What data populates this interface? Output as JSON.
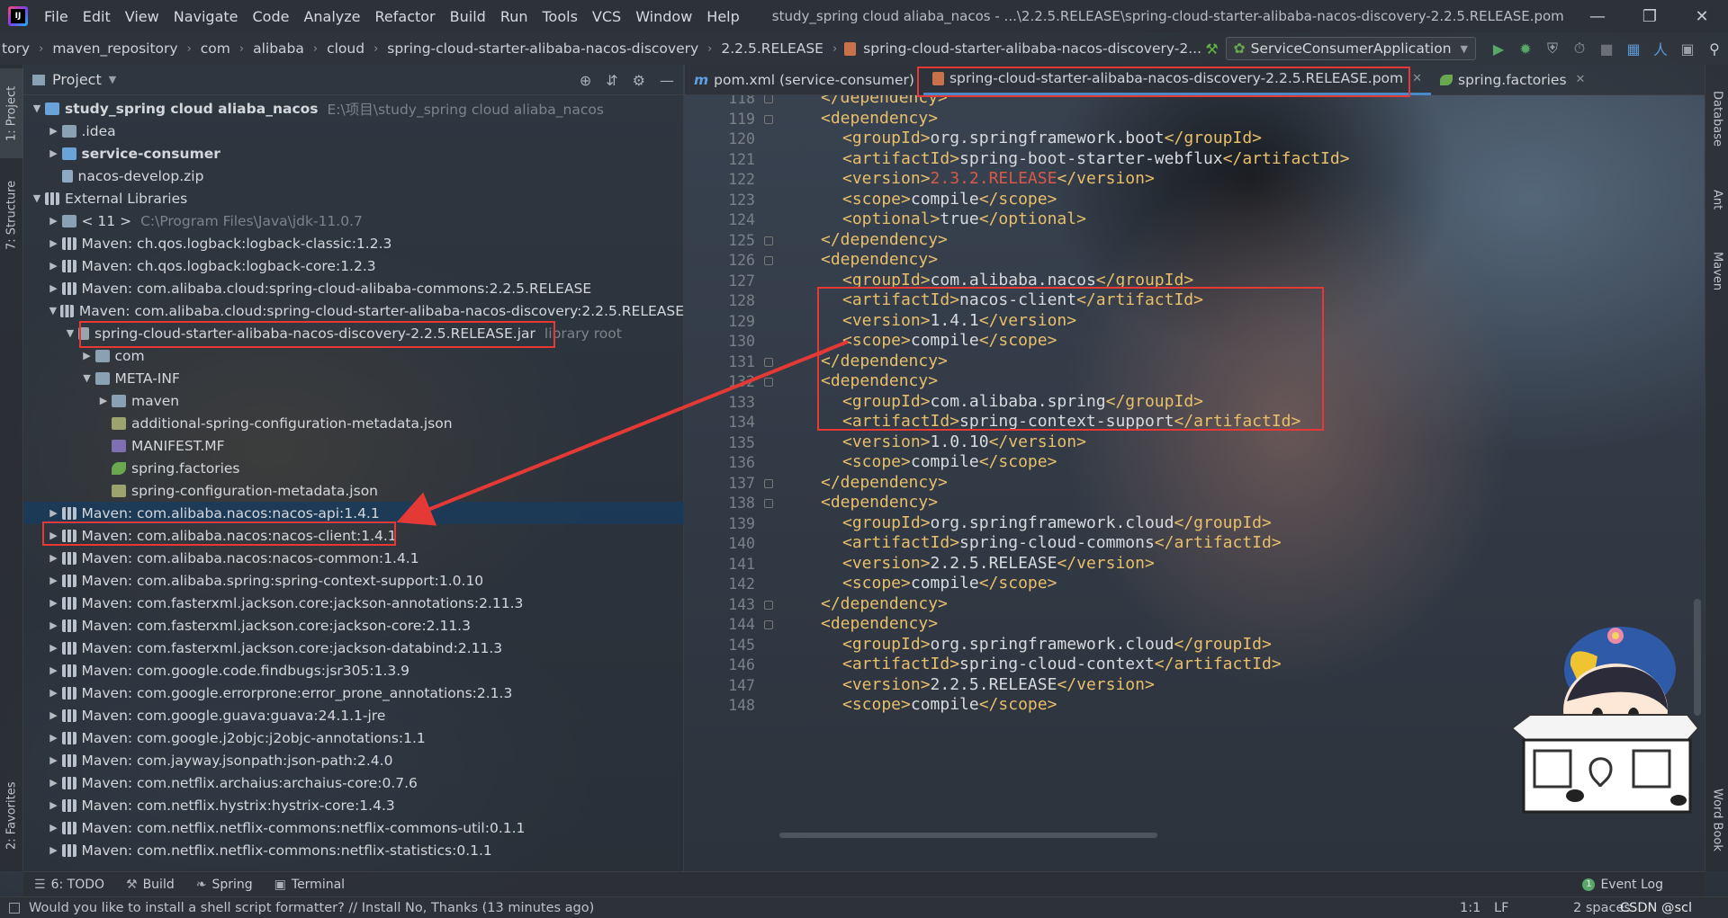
{
  "menubar": {
    "items": [
      "File",
      "Edit",
      "View",
      "Navigate",
      "Code",
      "Analyze",
      "Refactor",
      "Build",
      "Run",
      "Tools",
      "VCS",
      "Window",
      "Help"
    ],
    "window_title": "study_spring cloud aliaba_nacos - ...\\2.2.5.RELEASE\\spring-cloud-starter-alibaba-nacos-discovery-2.2.5.RELEASE.pom"
  },
  "breadcrumb": [
    "tory",
    "maven_repository",
    "com",
    "alibaba",
    "cloud",
    "spring-cloud-starter-alibaba-nacos-discovery",
    "2.2.5.RELEASE",
    "spring-cloud-starter-alibaba-nacos-discovery-2..."
  ],
  "run_config": "ServiceConsumerApplication",
  "left_strip": {
    "project_tab": "1: Project",
    "structure_tab": "7: Structure",
    "favorites_tab": "2: Favorites"
  },
  "right_strip": {
    "database_tab": "Database",
    "ant_tab": "Ant",
    "maven_tab": "Maven",
    "wordbook_tab": "Word Book"
  },
  "project_panel": {
    "title": "Project",
    "tree": [
      {
        "indent": 0,
        "arrow": "down",
        "icon": "folder-blue",
        "text": "study_spring cloud aliaba_nacos",
        "bold": true,
        "dim": "E:\\项目\\study_spring cloud aliaba_nacos"
      },
      {
        "indent": 1,
        "arrow": "right",
        "icon": "folder",
        "text": ".idea"
      },
      {
        "indent": 1,
        "arrow": "right",
        "icon": "folder-blue",
        "text": "service-consumer",
        "bold": true
      },
      {
        "indent": 1,
        "arrow": "",
        "icon": "zip",
        "text": "nacos-develop.zip"
      },
      {
        "indent": 0,
        "arrow": "down",
        "icon": "lib",
        "text": "External Libraries"
      },
      {
        "indent": 1,
        "arrow": "right",
        "icon": "folder",
        "text": "< 11 >",
        "dim": "C:\\Program Files\\Java\\jdk-11.0.7"
      },
      {
        "indent": 1,
        "arrow": "right",
        "icon": "lib",
        "text": "Maven: ch.qos.logback:logback-classic:1.2.3"
      },
      {
        "indent": 1,
        "arrow": "right",
        "icon": "lib",
        "text": "Maven: ch.qos.logback:logback-core:1.2.3"
      },
      {
        "indent": 1,
        "arrow": "right",
        "icon": "lib",
        "text": "Maven: com.alibaba.cloud:spring-cloud-alibaba-commons:2.2.5.RELEASE"
      },
      {
        "indent": 1,
        "arrow": "down",
        "icon": "lib",
        "text": "Maven: com.alibaba.cloud:spring-cloud-starter-alibaba-nacos-discovery:2.2.5.RELEASE"
      },
      {
        "indent": 2,
        "arrow": "down",
        "icon": "jar",
        "text": "spring-cloud-starter-alibaba-nacos-discovery-2.2.5.RELEASE.jar",
        "dim": "library root"
      },
      {
        "indent": 3,
        "arrow": "right",
        "icon": "folder",
        "text": "com"
      },
      {
        "indent": 3,
        "arrow": "down",
        "icon": "folder",
        "text": "META-INF"
      },
      {
        "indent": 4,
        "arrow": "right",
        "icon": "folder",
        "text": "maven"
      },
      {
        "indent": 4,
        "arrow": "",
        "icon": "json",
        "text": "additional-spring-configuration-metadata.json"
      },
      {
        "indent": 4,
        "arrow": "",
        "icon": "mf",
        "text": "MANIFEST.MF"
      },
      {
        "indent": 4,
        "arrow": "",
        "icon": "leaf",
        "text": "spring.factories"
      },
      {
        "indent": 4,
        "arrow": "",
        "icon": "json",
        "text": "spring-configuration-metadata.json"
      },
      {
        "indent": 1,
        "arrow": "right",
        "icon": "lib",
        "text": "Maven: com.alibaba.nacos:nacos-api:1.4.1",
        "selected": true
      },
      {
        "indent": 1,
        "arrow": "right",
        "icon": "lib",
        "text": "Maven: com.alibaba.nacos:nacos-client:1.4.1"
      },
      {
        "indent": 1,
        "arrow": "right",
        "icon": "lib",
        "text": "Maven: com.alibaba.nacos:nacos-common:1.4.1"
      },
      {
        "indent": 1,
        "arrow": "right",
        "icon": "lib",
        "text": "Maven: com.alibaba.spring:spring-context-support:1.0.10"
      },
      {
        "indent": 1,
        "arrow": "right",
        "icon": "lib",
        "text": "Maven: com.fasterxml.jackson.core:jackson-annotations:2.11.3"
      },
      {
        "indent": 1,
        "arrow": "right",
        "icon": "lib",
        "text": "Maven: com.fasterxml.jackson.core:jackson-core:2.11.3"
      },
      {
        "indent": 1,
        "arrow": "right",
        "icon": "lib",
        "text": "Maven: com.fasterxml.jackson.core:jackson-databind:2.11.3"
      },
      {
        "indent": 1,
        "arrow": "right",
        "icon": "lib",
        "text": "Maven: com.google.code.findbugs:jsr305:1.3.9"
      },
      {
        "indent": 1,
        "arrow": "right",
        "icon": "lib",
        "text": "Maven: com.google.errorprone:error_prone_annotations:2.1.3"
      },
      {
        "indent": 1,
        "arrow": "right",
        "icon": "lib",
        "text": "Maven: com.google.guava:guava:24.1.1-jre"
      },
      {
        "indent": 1,
        "arrow": "right",
        "icon": "lib",
        "text": "Maven: com.google.j2objc:j2objc-annotations:1.1"
      },
      {
        "indent": 1,
        "arrow": "right",
        "icon": "lib",
        "text": "Maven: com.jayway.jsonpath:json-path:2.4.0"
      },
      {
        "indent": 1,
        "arrow": "right",
        "icon": "lib",
        "text": "Maven: com.netflix.archaius:archaius-core:0.7.6"
      },
      {
        "indent": 1,
        "arrow": "right",
        "icon": "lib",
        "text": "Maven: com.netflix.hystrix:hystrix-core:1.4.3"
      },
      {
        "indent": 1,
        "arrow": "right",
        "icon": "lib",
        "text": "Maven: com.netflix.netflix-commons:netflix-commons-util:0.1.1"
      },
      {
        "indent": 1,
        "arrow": "right",
        "icon": "lib",
        "text": "Maven: com.netflix.netflix-commons:netflix-statistics:0.1.1"
      }
    ]
  },
  "editor_tabs": [
    {
      "label": "pom.xml (service-consumer)",
      "icon": "m-icon",
      "active": false,
      "close": false
    },
    {
      "label": "spring-cloud-starter-alibaba-nacos-discovery-2.2.5.RELEASE.pom",
      "icon": "xml-icon",
      "active": true,
      "close": true
    },
    {
      "label": "spring.factories",
      "icon": "leaf-icon",
      "active": false,
      "close": true
    }
  ],
  "editor": {
    "lines": [
      {
        "n": "118",
        "indent": 1,
        "parts": [
          [
            "tag",
            "</dependency>"
          ]
        ]
      },
      {
        "n": "119",
        "indent": 1,
        "parts": [
          [
            "tag",
            "<dependency>"
          ]
        ]
      },
      {
        "n": "120",
        "indent": 2,
        "parts": [
          [
            "tag",
            "<groupId>"
          ],
          [
            "text",
            "org.springframework.boot"
          ],
          [
            "tag",
            "</groupId>"
          ]
        ]
      },
      {
        "n": "121",
        "indent": 2,
        "parts": [
          [
            "tag",
            "<artifactId>"
          ],
          [
            "text",
            "spring-boot-starter-webflux"
          ],
          [
            "tag",
            "</artifactId>"
          ]
        ]
      },
      {
        "n": "122",
        "indent": 2,
        "parts": [
          [
            "tag",
            "<version>"
          ],
          [
            "red",
            "2.3.2.RELEASE"
          ],
          [
            "tag",
            "</version>"
          ]
        ]
      },
      {
        "n": "123",
        "indent": 2,
        "parts": [
          [
            "tag",
            "<scope>"
          ],
          [
            "text",
            "compile"
          ],
          [
            "tag",
            "</scope>"
          ]
        ]
      },
      {
        "n": "124",
        "indent": 2,
        "parts": [
          [
            "tag",
            "<optional>"
          ],
          [
            "text",
            "true"
          ],
          [
            "tag",
            "</optional>"
          ]
        ]
      },
      {
        "n": "125",
        "indent": 1,
        "parts": [
          [
            "tag",
            "</dependency>"
          ]
        ]
      },
      {
        "n": "126",
        "indent": 1,
        "parts": [
          [
            "tag",
            "<dependency>"
          ]
        ]
      },
      {
        "n": "127",
        "indent": 2,
        "parts": [
          [
            "tag",
            "<groupId>"
          ],
          [
            "text",
            "com.alibaba.nacos"
          ],
          [
            "tag",
            "</groupId>"
          ]
        ]
      },
      {
        "n": "128",
        "indent": 2,
        "parts": [
          [
            "tag",
            "<artifactId>"
          ],
          [
            "text",
            "nacos-client"
          ],
          [
            "tag",
            "</artifactId>"
          ]
        ]
      },
      {
        "n": "129",
        "indent": 2,
        "parts": [
          [
            "tag",
            "<version>"
          ],
          [
            "text",
            "1.4.1"
          ],
          [
            "tag",
            "</version>"
          ]
        ]
      },
      {
        "n": "130",
        "indent": 2,
        "parts": [
          [
            "tag",
            "<scope>"
          ],
          [
            "text",
            "compile"
          ],
          [
            "tag",
            "</scope>"
          ]
        ]
      },
      {
        "n": "131",
        "indent": 1,
        "parts": [
          [
            "tag",
            "</dependency>"
          ]
        ]
      },
      {
        "n": "132",
        "indent": 1,
        "parts": [
          [
            "tag",
            "<dependency>"
          ]
        ]
      },
      {
        "n": "133",
        "indent": 2,
        "parts": [
          [
            "tag",
            "<groupId>"
          ],
          [
            "text",
            "com.alibaba.spring"
          ],
          [
            "tag",
            "</groupId>"
          ]
        ]
      },
      {
        "n": "134",
        "indent": 2,
        "parts": [
          [
            "tag",
            "<artifactId>"
          ],
          [
            "text",
            "spring-context-support"
          ],
          [
            "tag",
            "</artifactId>"
          ]
        ]
      },
      {
        "n": "135",
        "indent": 2,
        "parts": [
          [
            "tag",
            "<version>"
          ],
          [
            "text",
            "1.0.10"
          ],
          [
            "tag",
            "</version>"
          ]
        ]
      },
      {
        "n": "136",
        "indent": 2,
        "parts": [
          [
            "tag",
            "<scope>"
          ],
          [
            "text",
            "compile"
          ],
          [
            "tag",
            "</scope>"
          ]
        ]
      },
      {
        "n": "137",
        "indent": 1,
        "parts": [
          [
            "tag",
            "</dependency>"
          ]
        ]
      },
      {
        "n": "138",
        "indent": 1,
        "parts": [
          [
            "tag",
            "<dependency>"
          ]
        ]
      },
      {
        "n": "139",
        "indent": 2,
        "parts": [
          [
            "tag",
            "<groupId>"
          ],
          [
            "text",
            "org.springframework.cloud"
          ],
          [
            "tag",
            "</groupId>"
          ]
        ]
      },
      {
        "n": "140",
        "indent": 2,
        "parts": [
          [
            "tag",
            "<artifactId>"
          ],
          [
            "text",
            "spring-cloud-commons"
          ],
          [
            "tag",
            "</artifactId>"
          ]
        ]
      },
      {
        "n": "141",
        "indent": 2,
        "parts": [
          [
            "tag",
            "<version>"
          ],
          [
            "text",
            "2.2.5.RELEASE"
          ],
          [
            "tag",
            "</version>"
          ]
        ]
      },
      {
        "n": "142",
        "indent": 2,
        "parts": [
          [
            "tag",
            "<scope>"
          ],
          [
            "text",
            "compile"
          ],
          [
            "tag",
            "</scope>"
          ]
        ]
      },
      {
        "n": "143",
        "indent": 1,
        "parts": [
          [
            "tag",
            "</dependency>"
          ]
        ]
      },
      {
        "n": "144",
        "indent": 1,
        "parts": [
          [
            "tag",
            "<dependency>"
          ]
        ]
      },
      {
        "n": "145",
        "indent": 2,
        "parts": [
          [
            "tag",
            "<groupId>"
          ],
          [
            "text",
            "org.springframework.cloud"
          ],
          [
            "tag",
            "</groupId>"
          ]
        ]
      },
      {
        "n": "146",
        "indent": 2,
        "parts": [
          [
            "tag",
            "<artifactId>"
          ],
          [
            "text",
            "spring-cloud-context"
          ],
          [
            "tag",
            "</artifactId>"
          ]
        ]
      },
      {
        "n": "147",
        "indent": 2,
        "parts": [
          [
            "tag",
            "<version>"
          ],
          [
            "text",
            "2.2.5.RELEASE"
          ],
          [
            "tag",
            "</version>"
          ]
        ]
      },
      {
        "n": "148",
        "indent": 2,
        "parts": [
          [
            "tag",
            "<scope>"
          ],
          [
            "text",
            "compile"
          ],
          [
            "tag",
            "</scope>"
          ]
        ]
      }
    ]
  },
  "tool_windows": [
    {
      "label": "6: TODO",
      "icon": "list-icon"
    },
    {
      "label": "Build",
      "icon": "hammer-icon"
    },
    {
      "label": "Spring",
      "icon": "leaf-icon"
    },
    {
      "label": "Terminal",
      "icon": "terminal-icon"
    }
  ],
  "event_log": {
    "label": "Event Log",
    "count": "1"
  },
  "status": {
    "message": "Would you like to install a shell script formatter? // Install   No, Thanks (13 minutes ago)",
    "position": "1:1",
    "line_sep": "LF",
    "indent": "2 spaces",
    "watermark": "CSDN @scl"
  },
  "colors": {
    "accent": "#4a88c7",
    "annotation": "#e53935",
    "tag": "#e8bf6a",
    "selection": "#183a5c"
  }
}
